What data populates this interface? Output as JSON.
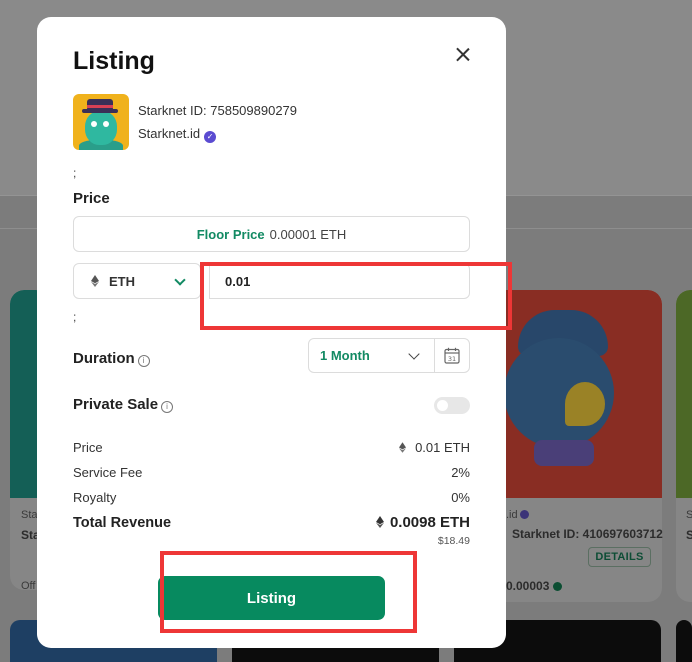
{
  "background": {
    "left_card": {
      "collection": "Star",
      "collection_short": "Sta",
      "offer": "Off"
    },
    "right_card": {
      "collection": ".id",
      "name": "Starknet ID: 410697603712",
      "details_button": "DETAILS",
      "price": "0.00003"
    },
    "edge_card": {
      "collection": "S",
      "collection_short": "S"
    }
  },
  "modal": {
    "title": "Listing",
    "nft": {
      "id_text": "Starknet ID: 758509890279",
      "collection": "Starknet.id"
    },
    "price_section": {
      "separator": ";",
      "label": "Price",
      "floor_label": "Floor Price",
      "floor_value": "0.00001 ETH",
      "currency": "ETH",
      "price_value": "0.01",
      "separator2": ";"
    },
    "duration": {
      "label": "Duration",
      "value": "1 Month"
    },
    "private_sale": {
      "label": "Private Sale",
      "enabled": false
    },
    "summary": {
      "price_label": "Price",
      "price_value": "0.01 ETH",
      "service_fee_label": "Service Fee",
      "service_fee_value": "2%",
      "royalty_label": "Royalty",
      "royalty_value": "0%",
      "total_label": "Total Revenue",
      "total_value": "0.0098 ETH",
      "total_usd": "$18.49"
    },
    "submit_label": "Listing"
  },
  "icons": {
    "close": "close-icon",
    "eth": "ethereum-icon",
    "calendar": "calendar-icon",
    "info": "info-icon",
    "verified": "verified-badge-icon"
  },
  "colors": {
    "accent_green": "#078a5f",
    "floor_green": "#128a63",
    "verified_purple": "#5a4bd1",
    "annotation_red": "#ee3636"
  }
}
